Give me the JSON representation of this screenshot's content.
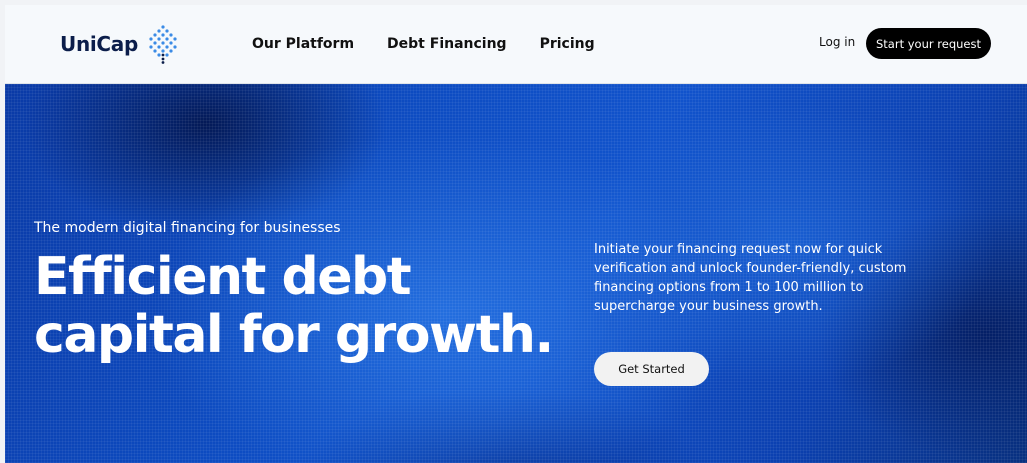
{
  "header": {
    "logo_text": "UniCap",
    "nav": [
      {
        "label": "Our Platform"
      },
      {
        "label": "Debt Financing"
      },
      {
        "label": "Pricing"
      }
    ],
    "login_label": "Log in",
    "cta_label": "Start your request"
  },
  "hero": {
    "kicker": "The modern digital financing for businesses",
    "title": "Efficient debt capital for growth.",
    "description": "Initiate your financing request now for quick verification and unlock founder-friendly, custom financing options from 1 to 100 million to supercharge your business growth.",
    "button_label": "Get Started"
  },
  "colors": {
    "logo": "#0b1d4a",
    "logo_mark": "#3b8be6",
    "hero_blue": "#0d4cc2",
    "cta_bg": "#000000"
  },
  "icons": {
    "logo_mark": "dotted-tree-icon"
  }
}
